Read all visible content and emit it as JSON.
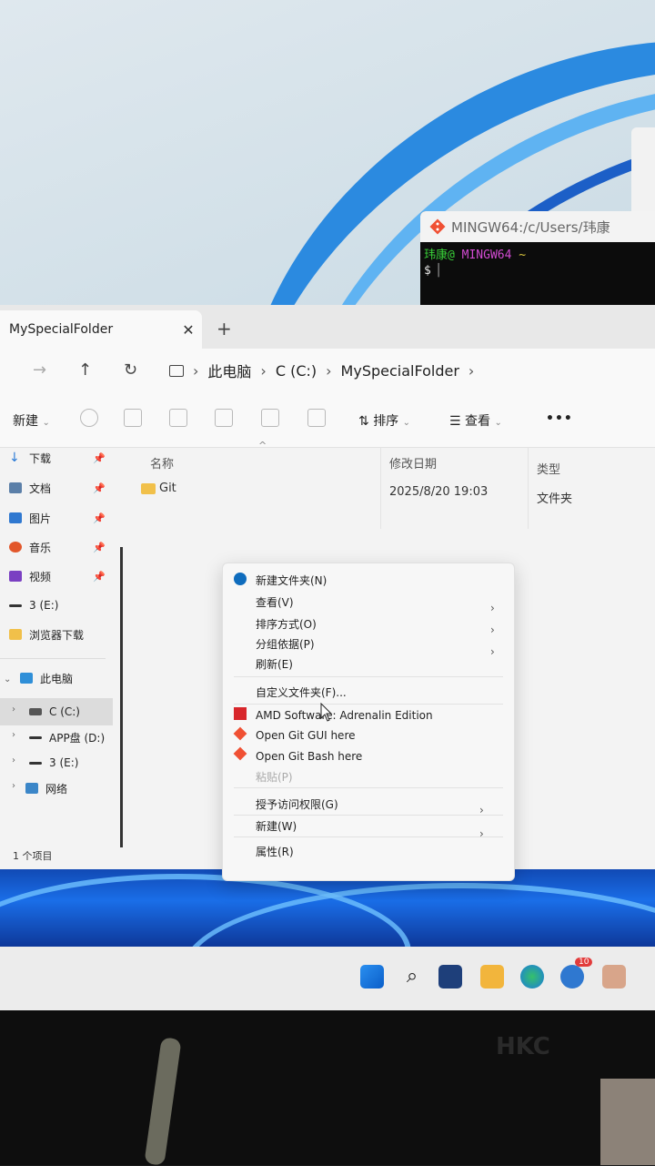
{
  "terminal": {
    "title": "MINGW64:/c/Users/玮康",
    "user": "玮康@",
    "host": "MINGW64",
    "path": "~",
    "prompt": "$"
  },
  "explorer": {
    "tab_title": "MySpecialFolder",
    "tab_close": "✕",
    "tab_new": "+",
    "breadcrumb": [
      "此电脑",
      "C (C:)",
      "MySpecialFolder"
    ],
    "toolbar": {
      "new_label": "新建",
      "sort_label": "排序",
      "view_label": "查看",
      "more_label": "•••"
    },
    "sidebar": {
      "quick": [
        {
          "label": "下载",
          "icon": "download-icon"
        },
        {
          "label": "文档",
          "icon": "document-icon"
        },
        {
          "label": "图片",
          "icon": "picture-icon"
        },
        {
          "label": "音乐",
          "icon": "music-icon"
        },
        {
          "label": "视频",
          "icon": "video-icon"
        },
        {
          "label": "3 (E:)",
          "icon": "drive-icon"
        },
        {
          "label": "浏览器下载",
          "icon": "folder-icon"
        }
      ],
      "this_pc": "此电脑",
      "drives": [
        "C (C:)",
        "APP盘 (D:)",
        "3 (E:)"
      ],
      "network": "网络"
    },
    "columns": {
      "name": "名称",
      "modified": "修改日期",
      "type": "类型"
    },
    "files": [
      {
        "name": "Git",
        "modified": "2025/8/20 19:03",
        "type": "文件夹"
      }
    ],
    "status": "1 个项目"
  },
  "context_menu": {
    "items": [
      "新建文件夹(N)",
      "查看(V)",
      "排序方式(O)",
      "分组依据(P)",
      "刷新(E)",
      "自定义文件夹(F)...",
      "AMD Software: Adrenalin Edition",
      "Open Git GUI here",
      "Open Git Bash here",
      "粘贴(P)",
      "授予访问权限(G)",
      "新建(W)",
      "属性(R)"
    ]
  },
  "taskbar": {
    "badge": "10"
  },
  "monitor": {
    "brand": "HKC"
  },
  "colors": {
    "accent_blue": "#0f6cbd",
    "git_orange": "#f05033",
    "amd_red": "#d8262b",
    "folder_yellow": "#f1c04a"
  }
}
